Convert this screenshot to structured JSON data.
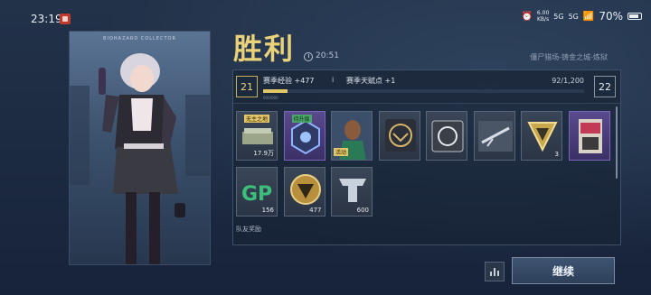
{
  "status_bar": {
    "time": "23:19",
    "net_speed_top": "6.00",
    "net_speed_unit": "KB/s",
    "signal_1": "5G",
    "signal_2": "5G",
    "battery": "70%"
  },
  "character": {
    "caption": "BIOHAZARD COLLECTOR"
  },
  "result": {
    "title": "胜利",
    "duration": "20:51",
    "map": "僵尸猎场-铸金之城-炼狱"
  },
  "season": {
    "current_level": "21",
    "next_level": "22",
    "exp_label": "赛季经验 +477",
    "info": "i",
    "talent_label": "赛季天赋点 +1",
    "progress_text": "92/1,200",
    "progress_fraction": 0.077,
    "mark_text": "000/000"
  },
  "rewards": [
    {
      "name": "cash-stack",
      "tag": "无主之地",
      "count": "17.9万",
      "style": "gray"
    },
    {
      "name": "upgrade-chip",
      "tag": "待升级",
      "count": "",
      "style": "purple"
    },
    {
      "name": "agent-portrait",
      "tag": "",
      "count": "",
      "subtag": "活动",
      "style": "gray"
    },
    {
      "name": "eagle-emblem",
      "tag": "",
      "count": "",
      "style": "gray"
    },
    {
      "name": "weapon-crate",
      "tag": "",
      "count": "",
      "style": "gray"
    },
    {
      "name": "rifle-blueprint",
      "tag": "",
      "count": "",
      "style": "gray"
    },
    {
      "name": "gold-triangle-badge",
      "tag": "",
      "count": "3",
      "style": "gray"
    },
    {
      "name": "graffiti-sticker",
      "tag": "",
      "count": "",
      "style": "purple"
    },
    {
      "name": "gp-coin",
      "tag": "",
      "count": "156",
      "style": "gray"
    },
    {
      "name": "season-token",
      "tag": "",
      "count": "477",
      "style": "gray"
    },
    {
      "name": "rank-token",
      "tag": "",
      "count": "600",
      "style": "gray"
    }
  ],
  "team_reward_label": "队友奖励",
  "buttons": {
    "continue": "继续"
  },
  "colors": {
    "gold": "#e9d27a",
    "panel_bg": "#1a2638",
    "purple_rarity": "#5a4a8e"
  }
}
